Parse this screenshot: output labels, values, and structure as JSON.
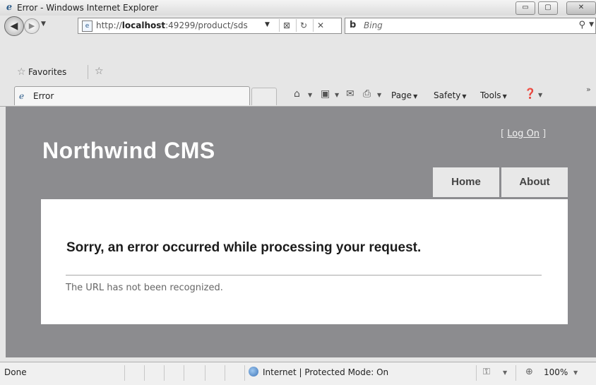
{
  "window": {
    "title": "Error - Windows Internet Explorer"
  },
  "address_bar": {
    "url_prefix": "http://",
    "url_host": "localhost",
    "url_rest": ":49299/product/sds",
    "search_placeholder": "Bing"
  },
  "favorites": {
    "label": "Favorites"
  },
  "tab": {
    "label": "Error"
  },
  "command_bar": {
    "page": "Page",
    "safety": "Safety",
    "tools": "Tools"
  },
  "site": {
    "login_open": "[ ",
    "login_link": "Log On",
    "login_close": " ]",
    "brand": "Northwind CMS",
    "menu": [
      "Home",
      "About"
    ],
    "error_heading": "Sorry, an error occurred while processing your request.",
    "error_message": "The URL has not been recognized."
  },
  "status_bar": {
    "status": "Done",
    "zone": "Internet | Protected Mode: On",
    "zoom": "100%"
  }
}
